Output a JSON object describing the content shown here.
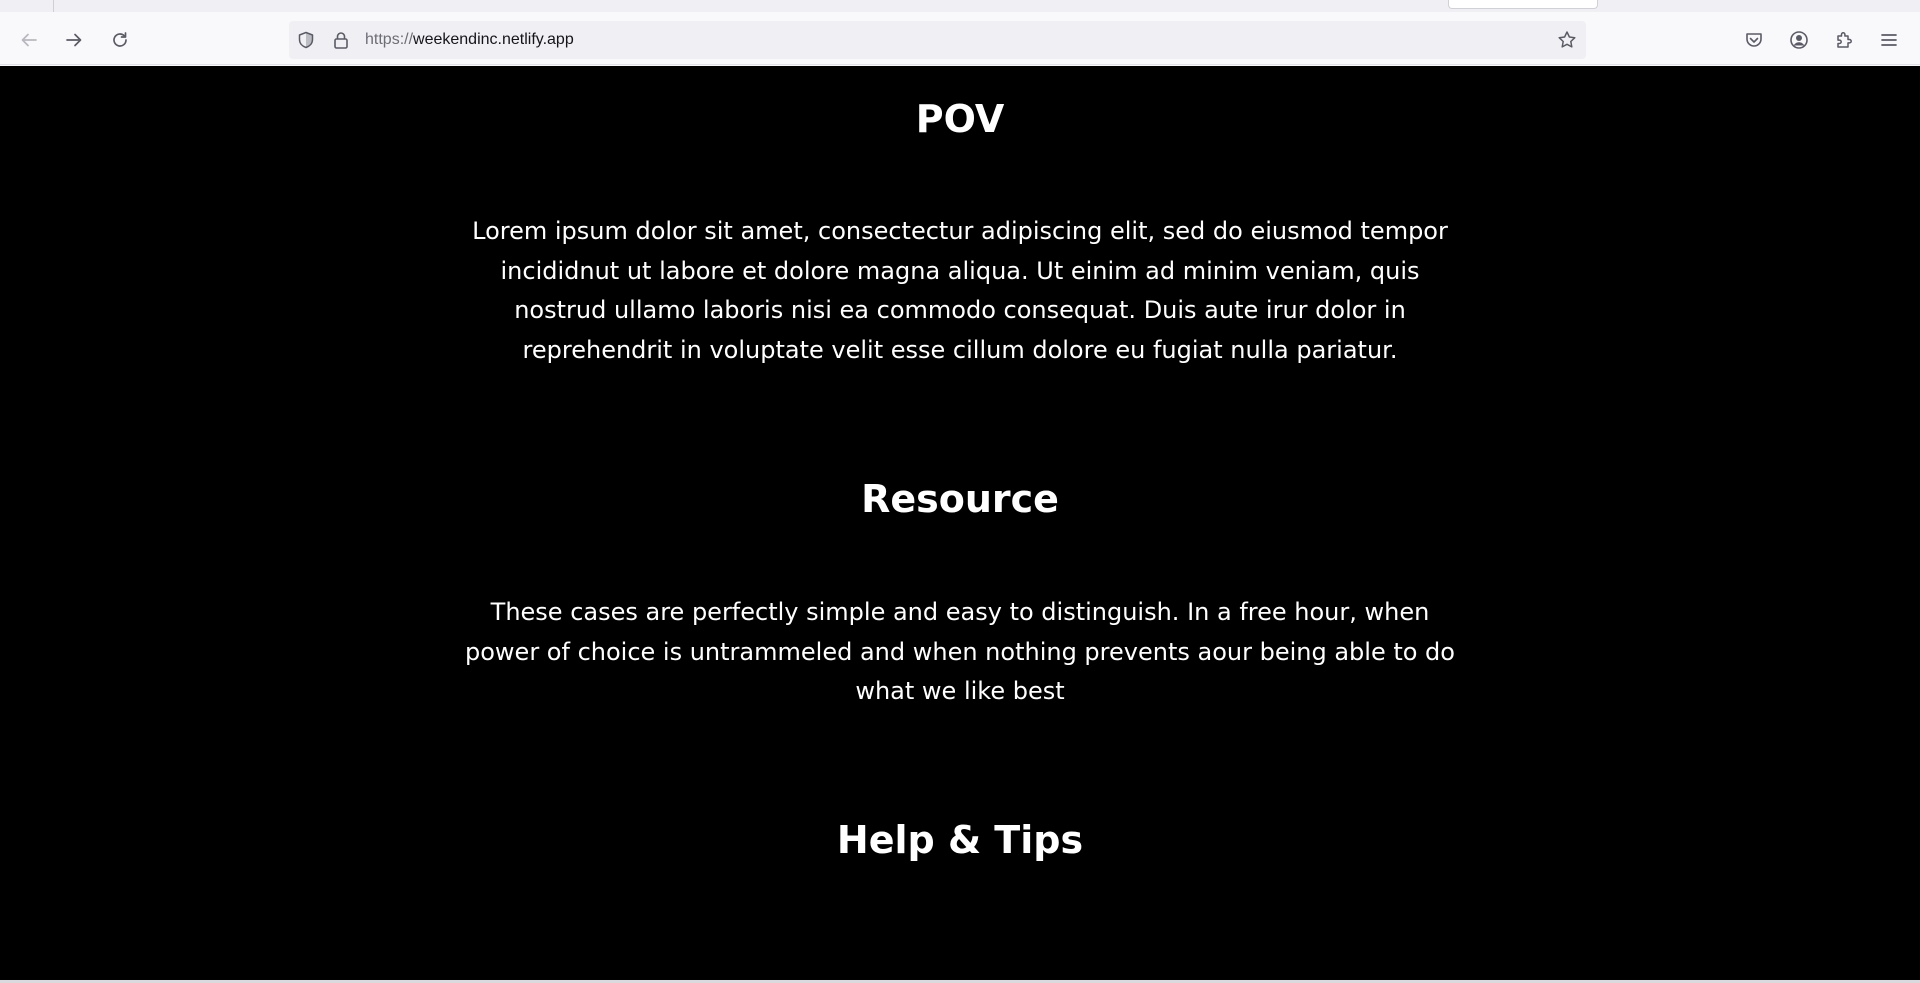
{
  "browser": {
    "url_scheme": "https://",
    "url_host": "weekendinc.netlify.app",
    "icons": {
      "back": "arrow-left-icon",
      "forward": "arrow-right-icon",
      "reload": "reload-icon",
      "tracking_protection": "shield-icon",
      "security": "lock-icon",
      "bookmark": "star-icon",
      "pocket": "pocket-icon",
      "account": "account-icon",
      "extensions": "puzzle-icon",
      "menu": "hamburger-menu-icon"
    }
  },
  "page": {
    "background": "#000000",
    "text_color": "#ffffff",
    "sections": [
      {
        "title": "POV",
        "body": "Lorem ipsum dolor sit amet, consectectur adipiscing elit, sed do eiusmod tempor incididnut ut labore et dolore magna aliqua. Ut einim ad minim veniam, quis nostrud ullamo laboris nisi ea commodo consequat. Duis aute irur dolor in reprehendrit in voluptate velit esse cillum dolore eu fugiat nulla pariatur."
      },
      {
        "title": "Resource",
        "body": "These cases are perfectly simple and easy to distinguish. In a free hour, when power of choice is untrammeled and when nothing prevents aour being able to do what we like best"
      },
      {
        "title": "Help & Tips"
      }
    ]
  }
}
